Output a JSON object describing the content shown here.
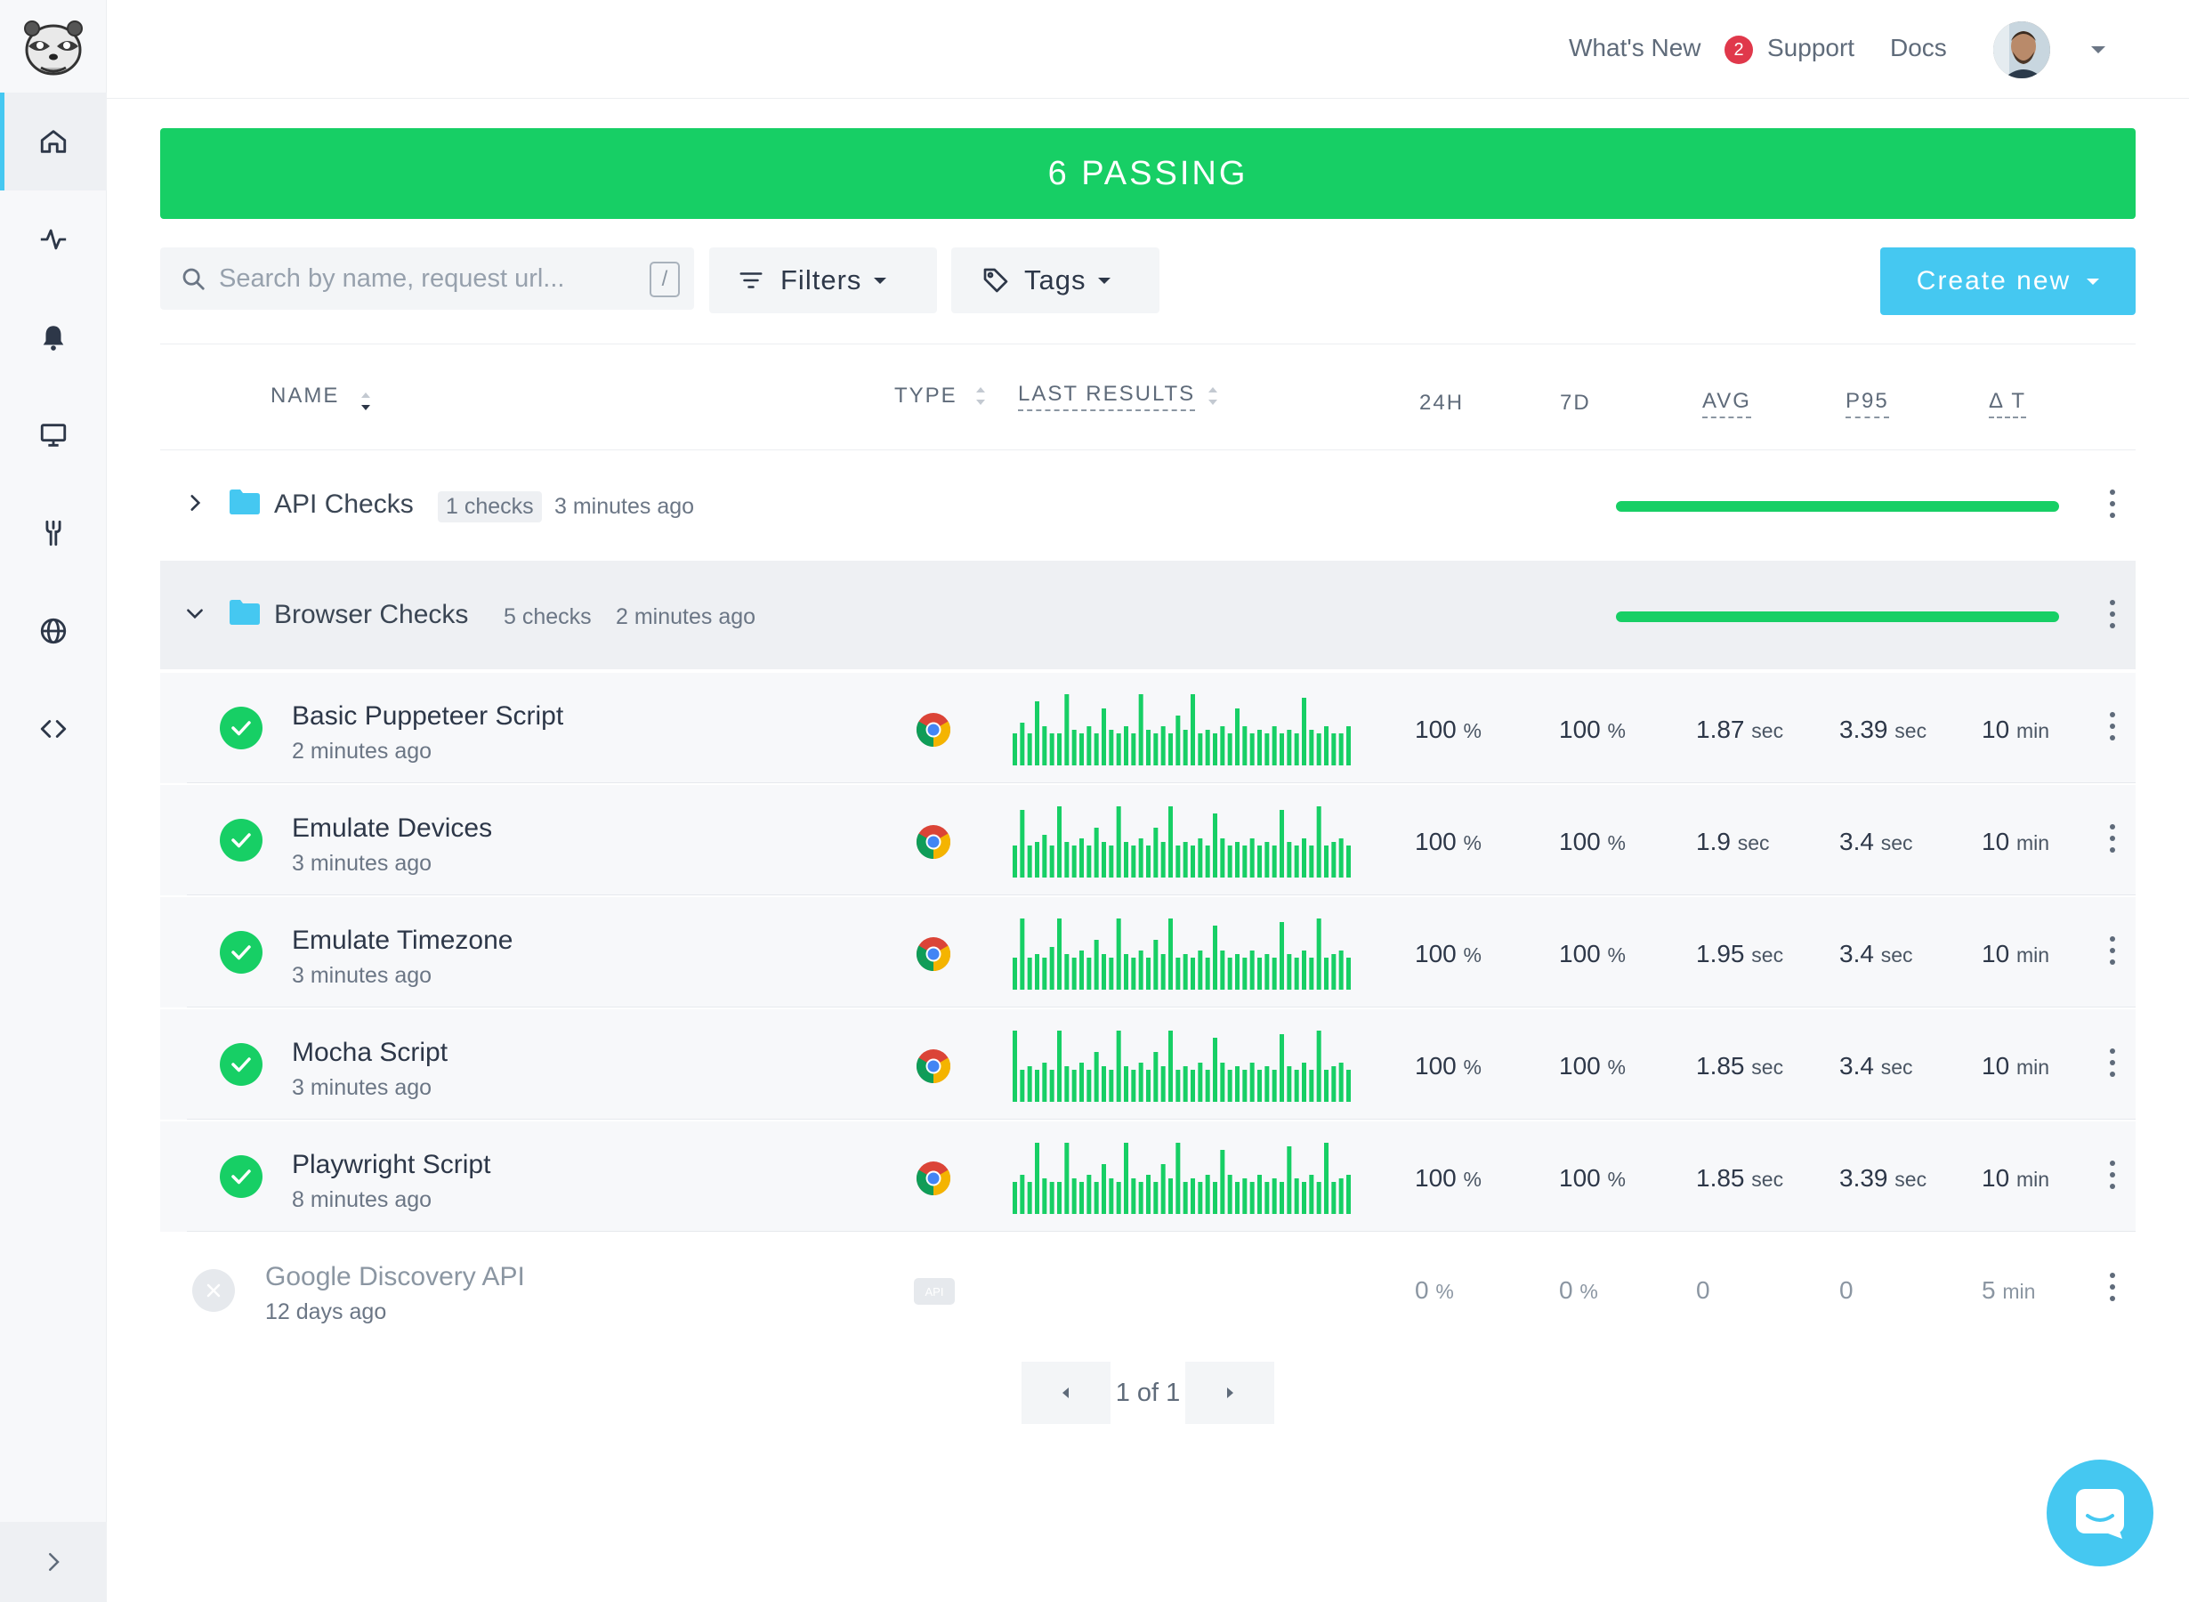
{
  "nav": {
    "items": [
      {
        "name": "home",
        "icon": "home-icon"
      },
      {
        "name": "activity",
        "icon": "activity-icon"
      },
      {
        "name": "alerts",
        "icon": "bell-icon"
      },
      {
        "name": "dashboards",
        "icon": "monitor-icon"
      },
      {
        "name": "tools",
        "icon": "wrench-icon"
      },
      {
        "name": "locations",
        "icon": "globe-icon"
      },
      {
        "name": "code",
        "icon": "code-icon"
      }
    ]
  },
  "topbar": {
    "whats_new": "What's New",
    "whats_new_count": "2",
    "support": "Support",
    "docs": "Docs"
  },
  "banner": {
    "text": "6 PASSING",
    "color": "#17cf65"
  },
  "toolbar": {
    "search_placeholder": "Search by name, request url...",
    "search_shortcut": "/",
    "filters_label": "Filters",
    "tags_label": "Tags",
    "create_label": "Create new"
  },
  "table": {
    "headers": {
      "name": "NAME",
      "type": "TYPE",
      "last_results": "LAST RESULTS",
      "h24": "24H",
      "d7": "7D",
      "avg": "AVG",
      "p95": "P95",
      "dt": "Δ T"
    },
    "groups": [
      {
        "name": "API Checks",
        "count": "1 checks",
        "time": "3 minutes ago",
        "expanded": false,
        "success_fraction": 1.0
      },
      {
        "name": "Browser Checks",
        "count": "5 checks",
        "time": "2 minutes ago",
        "expanded": true,
        "success_fraction": 1.0
      }
    ],
    "checks": [
      {
        "name": "Basic Puppeteer Script",
        "time": "2 minutes ago",
        "type": "chrome-icon",
        "results": [
          0.45,
          0.6,
          0.45,
          0.9,
          0.55,
          0.45,
          0.45,
          1.0,
          0.5,
          0.45,
          0.55,
          0.45,
          0.8,
          0.5,
          0.45,
          0.55,
          0.45,
          1.0,
          0.5,
          0.45,
          0.55,
          0.45,
          0.7,
          0.5,
          1.0,
          0.45,
          0.5,
          0.45,
          0.55,
          0.45,
          0.8,
          0.55,
          0.45,
          0.5,
          0.45,
          0.55,
          0.45,
          0.5,
          0.45,
          0.95,
          0.5,
          0.45,
          0.55,
          0.45,
          0.45,
          0.55
        ],
        "h24": "100",
        "h24_unit": "%",
        "d7": "100",
        "d7_unit": "%",
        "avg": "1.87",
        "avg_unit": "sec",
        "p95": "3.39",
        "p95_unit": "sec",
        "dt": "10",
        "dt_unit": "min"
      },
      {
        "name": "Emulate Devices",
        "time": "3 minutes ago",
        "type": "chrome-icon",
        "results": [
          0.45,
          0.95,
          0.45,
          0.5,
          0.6,
          0.45,
          1.0,
          0.5,
          0.45,
          0.55,
          0.45,
          0.7,
          0.5,
          0.45,
          1.0,
          0.5,
          0.45,
          0.55,
          0.45,
          0.7,
          0.5,
          1.0,
          0.45,
          0.5,
          0.45,
          0.55,
          0.45,
          0.9,
          0.55,
          0.45,
          0.5,
          0.45,
          0.55,
          0.45,
          0.5,
          0.45,
          0.95,
          0.5,
          0.45,
          0.55,
          0.45,
          1.0,
          0.45,
          0.5,
          0.55,
          0.45
        ],
        "h24": "100",
        "h24_unit": "%",
        "d7": "100",
        "d7_unit": "%",
        "avg": "1.9",
        "avg_unit": "sec",
        "p95": "3.4",
        "p95_unit": "sec",
        "dt": "10",
        "dt_unit": "min"
      },
      {
        "name": "Emulate Timezone",
        "time": "3 minutes ago",
        "type": "chrome-icon",
        "results": [
          0.45,
          1.0,
          0.45,
          0.5,
          0.45,
          0.6,
          1.0,
          0.5,
          0.45,
          0.55,
          0.45,
          0.7,
          0.5,
          0.45,
          1.0,
          0.5,
          0.45,
          0.55,
          0.45,
          0.7,
          0.5,
          1.0,
          0.45,
          0.5,
          0.45,
          0.55,
          0.45,
          0.9,
          0.55,
          0.45,
          0.5,
          0.45,
          0.55,
          0.45,
          0.5,
          0.45,
          0.95,
          0.5,
          0.45,
          0.55,
          0.45,
          1.0,
          0.45,
          0.5,
          0.55,
          0.45
        ],
        "h24": "100",
        "h24_unit": "%",
        "d7": "100",
        "d7_unit": "%",
        "avg": "1.95",
        "avg_unit": "sec",
        "p95": "3.4",
        "p95_unit": "sec",
        "dt": "10",
        "dt_unit": "min"
      },
      {
        "name": "Mocha Script",
        "time": "3 minutes ago",
        "type": "chrome-icon",
        "results": [
          1.0,
          0.45,
          0.5,
          0.45,
          0.55,
          0.45,
          1.0,
          0.5,
          0.45,
          0.55,
          0.45,
          0.7,
          0.5,
          0.45,
          1.0,
          0.5,
          0.45,
          0.55,
          0.45,
          0.7,
          0.5,
          1.0,
          0.45,
          0.5,
          0.45,
          0.55,
          0.45,
          0.9,
          0.55,
          0.45,
          0.5,
          0.45,
          0.55,
          0.45,
          0.5,
          0.45,
          0.95,
          0.5,
          0.45,
          0.55,
          0.45,
          1.0,
          0.45,
          0.5,
          0.55,
          0.45
        ],
        "h24": "100",
        "h24_unit": "%",
        "d7": "100",
        "d7_unit": "%",
        "avg": "1.85",
        "avg_unit": "sec",
        "p95": "3.4",
        "p95_unit": "sec",
        "dt": "10",
        "dt_unit": "min"
      },
      {
        "name": "Playwright Script",
        "time": "8 minutes ago",
        "type": "chrome-icon",
        "results": [
          0.45,
          0.55,
          0.45,
          1.0,
          0.5,
          0.45,
          0.45,
          1.0,
          0.5,
          0.45,
          0.55,
          0.45,
          0.7,
          0.5,
          0.45,
          1.0,
          0.5,
          0.45,
          0.55,
          0.45,
          0.7,
          0.5,
          1.0,
          0.45,
          0.5,
          0.45,
          0.55,
          0.45,
          0.9,
          0.55,
          0.45,
          0.5,
          0.45,
          0.55,
          0.45,
          0.5,
          0.45,
          0.95,
          0.5,
          0.45,
          0.55,
          0.45,
          1.0,
          0.45,
          0.5,
          0.55
        ],
        "h24": "100",
        "h24_unit": "%",
        "d7": "100",
        "d7_unit": "%",
        "avg": "1.85",
        "avg_unit": "sec",
        "p95": "3.39",
        "p95_unit": "sec",
        "dt": "10",
        "dt_unit": "min"
      },
      {
        "name": "Google Discovery API",
        "time": "12 days ago",
        "type": "API",
        "results": [],
        "h24": "0",
        "h24_unit": "%",
        "d7": "0",
        "d7_unit": "%",
        "avg": "0",
        "avg_unit": "",
        "p95": "0",
        "p95_unit": "",
        "dt": "5",
        "dt_unit": "min"
      }
    ]
  },
  "pagination": {
    "text": "1 of 1"
  },
  "colors": {
    "accent": "#45c8f1",
    "success": "#17cf65",
    "danger": "#e0384b"
  }
}
